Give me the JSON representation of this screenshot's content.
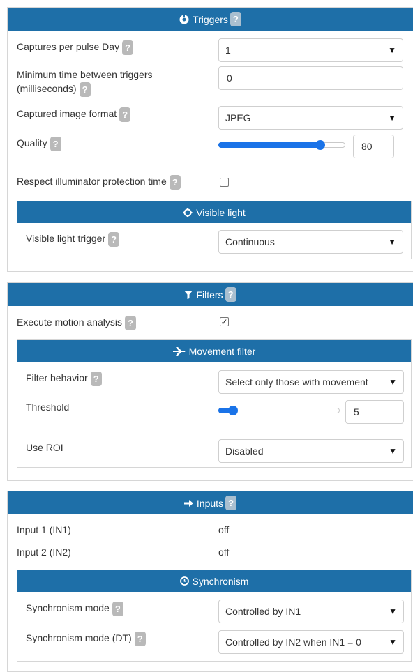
{
  "colors": {
    "header_bg": "#1e6fa8",
    "accent": "#1a73e8"
  },
  "triggers": {
    "title": "Triggers",
    "captures_label": "Captures per pulse Day",
    "captures_value": "1",
    "min_time_label_1": "Minimum time between triggers",
    "min_time_label_2": "(milliseconds)",
    "min_time_value": "0",
    "format_label": "Captured image format",
    "format_value": "JPEG",
    "quality_label": "Quality",
    "quality_value": "80",
    "quality_fraction": 0.8,
    "respect_label": "Respect illuminator protection time",
    "respect_checked": false,
    "visible": {
      "title": "Visible light",
      "trigger_label": "Visible light trigger",
      "trigger_value": "Continuous"
    }
  },
  "filters": {
    "title": "Filters",
    "motion_label": "Execute motion analysis",
    "motion_checked": true,
    "movement": {
      "title": "Movement filter",
      "behavior_label": "Filter behavior",
      "behavior_value": "Select only those with movement",
      "threshold_label": "Threshold",
      "threshold_value": "5",
      "threshold_fraction": 0.12,
      "roi_label": "Use ROI",
      "roi_value": "Disabled"
    }
  },
  "inputs": {
    "title": "Inputs",
    "in1_label": "Input 1 (IN1)",
    "in1_value": "off",
    "in2_label": "Input 2 (IN2)",
    "in2_value": "off",
    "sync": {
      "title": "Synchronism",
      "mode_label": "Synchronism mode",
      "mode_value": "Controlled by IN1",
      "mode_dt_label": "Synchronism mode (DT)",
      "mode_dt_value": "Controlled by IN2 when IN1 = 0"
    }
  },
  "help_glyph": "?",
  "dropdown_glyph": "▼",
  "check_glyph": "✓"
}
